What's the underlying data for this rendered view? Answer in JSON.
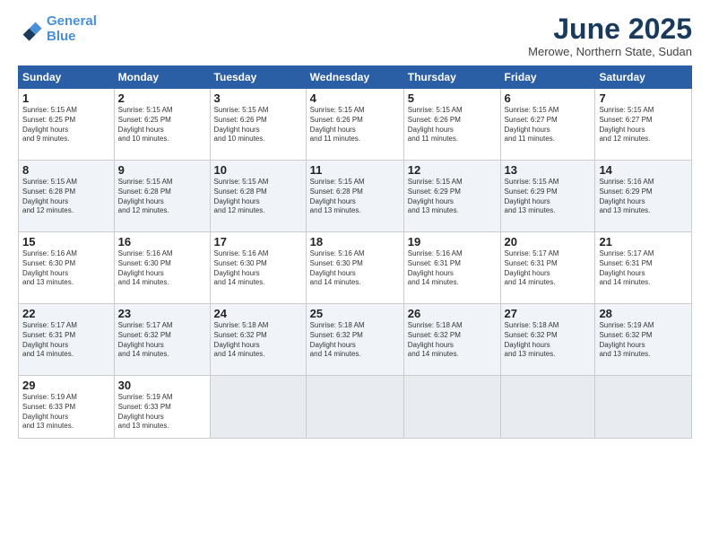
{
  "logo": {
    "line1": "General",
    "line2": "Blue"
  },
  "title": "June 2025",
  "subtitle": "Merowe, Northern State, Sudan",
  "days_of_week": [
    "Sunday",
    "Monday",
    "Tuesday",
    "Wednesday",
    "Thursday",
    "Friday",
    "Saturday"
  ],
  "weeks": [
    [
      {
        "day": "1",
        "sunrise": "5:15 AM",
        "sunset": "6:25 PM",
        "daylight": "13 hours and 9 minutes."
      },
      {
        "day": "2",
        "sunrise": "5:15 AM",
        "sunset": "6:25 PM",
        "daylight": "13 hours and 10 minutes."
      },
      {
        "day": "3",
        "sunrise": "5:15 AM",
        "sunset": "6:26 PM",
        "daylight": "13 hours and 10 minutes."
      },
      {
        "day": "4",
        "sunrise": "5:15 AM",
        "sunset": "6:26 PM",
        "daylight": "13 hours and 11 minutes."
      },
      {
        "day": "5",
        "sunrise": "5:15 AM",
        "sunset": "6:26 PM",
        "daylight": "13 hours and 11 minutes."
      },
      {
        "day": "6",
        "sunrise": "5:15 AM",
        "sunset": "6:27 PM",
        "daylight": "13 hours and 11 minutes."
      },
      {
        "day": "7",
        "sunrise": "5:15 AM",
        "sunset": "6:27 PM",
        "daylight": "13 hours and 12 minutes."
      }
    ],
    [
      {
        "day": "8",
        "sunrise": "5:15 AM",
        "sunset": "6:28 PM",
        "daylight": "13 hours and 12 minutes."
      },
      {
        "day": "9",
        "sunrise": "5:15 AM",
        "sunset": "6:28 PM",
        "daylight": "13 hours and 12 minutes."
      },
      {
        "day": "10",
        "sunrise": "5:15 AM",
        "sunset": "6:28 PM",
        "daylight": "13 hours and 12 minutes."
      },
      {
        "day": "11",
        "sunrise": "5:15 AM",
        "sunset": "6:28 PM",
        "daylight": "13 hours and 13 minutes."
      },
      {
        "day": "12",
        "sunrise": "5:15 AM",
        "sunset": "6:29 PM",
        "daylight": "13 hours and 13 minutes."
      },
      {
        "day": "13",
        "sunrise": "5:15 AM",
        "sunset": "6:29 PM",
        "daylight": "13 hours and 13 minutes."
      },
      {
        "day": "14",
        "sunrise": "5:16 AM",
        "sunset": "6:29 PM",
        "daylight": "13 hours and 13 minutes."
      }
    ],
    [
      {
        "day": "15",
        "sunrise": "5:16 AM",
        "sunset": "6:30 PM",
        "daylight": "13 hours and 13 minutes."
      },
      {
        "day": "16",
        "sunrise": "5:16 AM",
        "sunset": "6:30 PM",
        "daylight": "13 hours and 14 minutes."
      },
      {
        "day": "17",
        "sunrise": "5:16 AM",
        "sunset": "6:30 PM",
        "daylight": "13 hours and 14 minutes."
      },
      {
        "day": "18",
        "sunrise": "5:16 AM",
        "sunset": "6:30 PM",
        "daylight": "13 hours and 14 minutes."
      },
      {
        "day": "19",
        "sunrise": "5:16 AM",
        "sunset": "6:31 PM",
        "daylight": "13 hours and 14 minutes."
      },
      {
        "day": "20",
        "sunrise": "5:17 AM",
        "sunset": "6:31 PM",
        "daylight": "13 hours and 14 minutes."
      },
      {
        "day": "21",
        "sunrise": "5:17 AM",
        "sunset": "6:31 PM",
        "daylight": "13 hours and 14 minutes."
      }
    ],
    [
      {
        "day": "22",
        "sunrise": "5:17 AM",
        "sunset": "6:31 PM",
        "daylight": "13 hours and 14 minutes."
      },
      {
        "day": "23",
        "sunrise": "5:17 AM",
        "sunset": "6:32 PM",
        "daylight": "13 hours and 14 minutes."
      },
      {
        "day": "24",
        "sunrise": "5:18 AM",
        "sunset": "6:32 PM",
        "daylight": "13 hours and 14 minutes."
      },
      {
        "day": "25",
        "sunrise": "5:18 AM",
        "sunset": "6:32 PM",
        "daylight": "13 hours and 14 minutes."
      },
      {
        "day": "26",
        "sunrise": "5:18 AM",
        "sunset": "6:32 PM",
        "daylight": "13 hours and 14 minutes."
      },
      {
        "day": "27",
        "sunrise": "5:18 AM",
        "sunset": "6:32 PM",
        "daylight": "13 hours and 13 minutes."
      },
      {
        "day": "28",
        "sunrise": "5:19 AM",
        "sunset": "6:32 PM",
        "daylight": "13 hours and 13 minutes."
      }
    ],
    [
      {
        "day": "29",
        "sunrise": "5:19 AM",
        "sunset": "6:33 PM",
        "daylight": "13 hours and 13 minutes."
      },
      {
        "day": "30",
        "sunrise": "5:19 AM",
        "sunset": "6:33 PM",
        "daylight": "13 hours and 13 minutes."
      },
      null,
      null,
      null,
      null,
      null
    ]
  ]
}
